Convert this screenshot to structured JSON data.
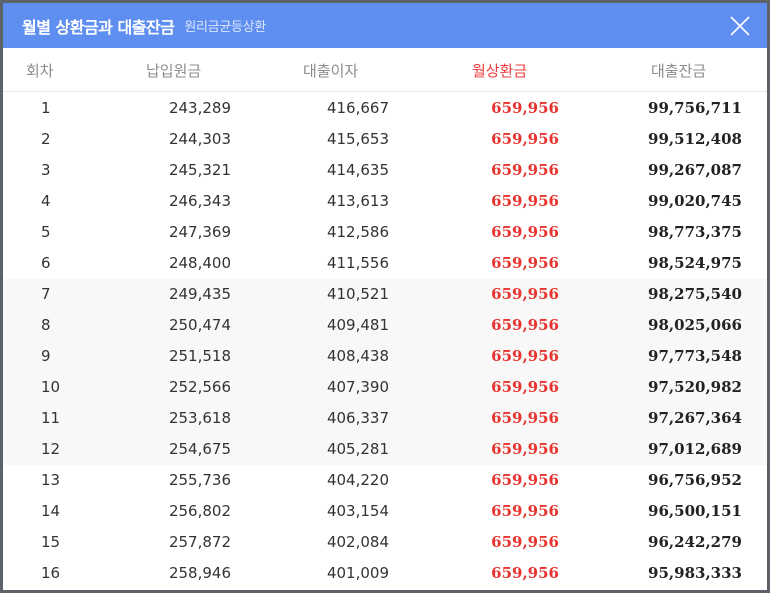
{
  "dialog": {
    "title": "월별 상환금과 대출잔금",
    "subtitle": "원리금균등상환"
  },
  "table": {
    "headers": [
      "회차",
      "납입원금",
      "대출이자",
      "월상환금",
      "대출잔금"
    ],
    "rows": [
      [
        "1",
        "243,289",
        "416,667",
        "659,956",
        "99,756,711"
      ],
      [
        "2",
        "244,303",
        "415,653",
        "659,956",
        "99,512,408"
      ],
      [
        "3",
        "245,321",
        "414,635",
        "659,956",
        "99,267,087"
      ],
      [
        "4",
        "246,343",
        "413,613",
        "659,956",
        "99,020,745"
      ],
      [
        "5",
        "247,369",
        "412,586",
        "659,956",
        "98,773,375"
      ],
      [
        "6",
        "248,400",
        "411,556",
        "659,956",
        "98,524,975"
      ],
      [
        "7",
        "249,435",
        "410,521",
        "659,956",
        "98,275,540"
      ],
      [
        "8",
        "250,474",
        "409,481",
        "659,956",
        "98,025,066"
      ],
      [
        "9",
        "251,518",
        "408,438",
        "659,956",
        "97,773,548"
      ],
      [
        "10",
        "252,566",
        "407,390",
        "659,956",
        "97,520,982"
      ],
      [
        "11",
        "253,618",
        "406,337",
        "659,956",
        "97,267,364"
      ],
      [
        "12",
        "254,675",
        "405,281",
        "659,956",
        "97,012,689"
      ],
      [
        "13",
        "255,736",
        "404,220",
        "659,956",
        "96,756,952"
      ],
      [
        "14",
        "256,802",
        "403,154",
        "659,956",
        "96,500,151"
      ],
      [
        "15",
        "257,872",
        "402,084",
        "659,956",
        "96,242,279"
      ],
      [
        "16",
        "258,946",
        "401,009",
        "659,956",
        "95,983,333"
      ]
    ]
  },
  "colors": {
    "titlebar": "#5e8ff0",
    "highlight": "#e8342f",
    "shaded_row": "#f8f8f8"
  },
  "icons": {
    "close": "close-icon"
  }
}
